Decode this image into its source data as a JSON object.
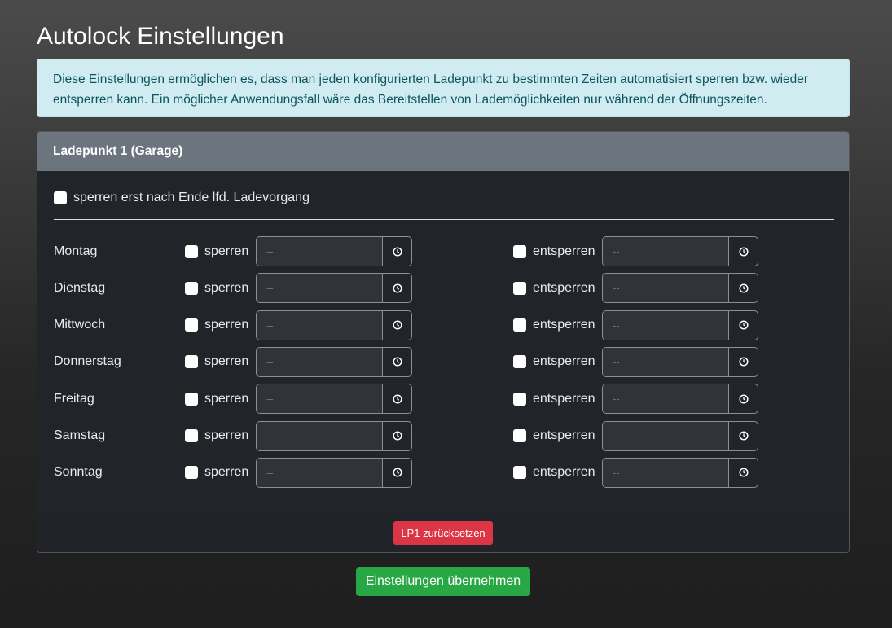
{
  "title": "Autolock Einstellungen",
  "info": "Diese Einstellungen ermöglichen es, dass man jeden konfigurierten Ladepunkt zu bestimmten Zeiten automatisiert sperren bzw. wieder entsperren kann. Ein möglicher Anwendungsfall wäre das Bereitstellen von Lademöglichkeiten nur während der Öffnungszeiten.",
  "card": {
    "header": "Ladepunkt 1 (Garage)",
    "option_label": "sperren erst nach Ende lfd. Ladevorgang",
    "lock_label": "sperren",
    "unlock_label": "entsperren",
    "placeholder": "--",
    "days": [
      "Montag",
      "Dienstag",
      "Mittwoch",
      "Donnerstag",
      "Freitag",
      "Samstag",
      "Sonntag"
    ],
    "reset_label": "LP1 zurücksetzen"
  },
  "submit_label": "Einstellungen übernehmen"
}
